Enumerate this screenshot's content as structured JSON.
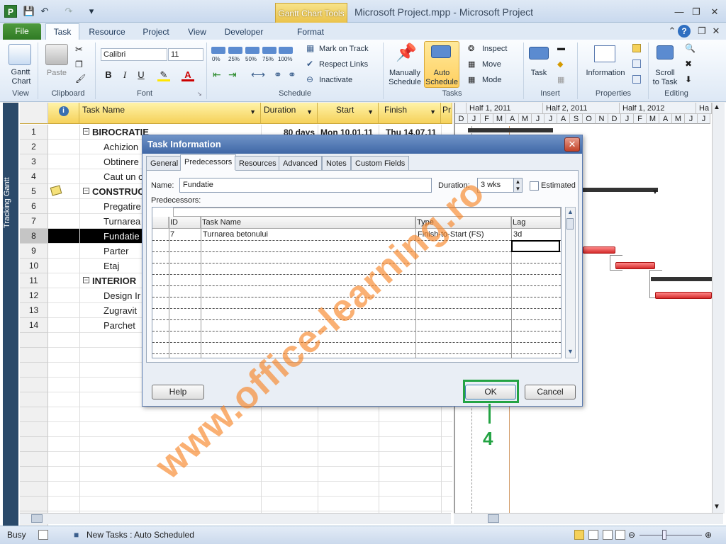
{
  "window": {
    "title": "Microsoft Project.mpp - Microsoft Project",
    "context_tab": "Gantt Chart Tools"
  },
  "tabs": [
    "File",
    "Task",
    "Resource",
    "Project",
    "View",
    "Developer",
    "Format"
  ],
  "ribbon": {
    "view": {
      "gantt": "Gantt",
      "chart": "Chart",
      "label": "View"
    },
    "clipboard": {
      "paste": "Paste",
      "label": "Clipboard"
    },
    "font": {
      "family": "Calibri",
      "size": "11",
      "label": "Font",
      "bold": "B",
      "italic": "I",
      "underline": "U"
    },
    "schedule": {
      "percents": [
        "0%",
        "25%",
        "50%",
        "75%",
        "100%"
      ],
      "mark_on_track": "Mark on Track",
      "respect_links": "Respect Links",
      "inactivate": "Inactivate",
      "label": "Schedule"
    },
    "tasks": {
      "manually": "Manually",
      "schedule1": "Schedule",
      "auto": "Auto",
      "schedule2": "Schedule",
      "inspect": "Inspect",
      "move": "Move",
      "mode": "Mode",
      "label": "Tasks"
    },
    "insert": {
      "task": "Task",
      "label": "Insert"
    },
    "properties": {
      "information": "Information",
      "label": "Properties"
    },
    "editing": {
      "scroll": "Scroll",
      "to_task": "to Task",
      "label": "Editing"
    }
  },
  "sidebar": {
    "label": "Tracking Gantt"
  },
  "grid": {
    "headers": {
      "task_name": "Task Name",
      "duration": "Duration",
      "start": "Start",
      "finish": "Finish",
      "pr": "Pr"
    },
    "summary_row": {
      "duration": "80 days",
      "start": "Mon 10.01.11",
      "finish": "Thu 14.07.11"
    },
    "rows": [
      {
        "id": "1",
        "name": "BIROCRATIE",
        "summary": true
      },
      {
        "id": "2",
        "name": "Achizion"
      },
      {
        "id": "3",
        "name": "Obtinere"
      },
      {
        "id": "4",
        "name": "Caut un c"
      },
      {
        "id": "5",
        "name": "CONSTRUCT",
        "summary": true
      },
      {
        "id": "6",
        "name": "Pregatire"
      },
      {
        "id": "7",
        "name": "Turnarea"
      },
      {
        "id": "8",
        "name": "Fundatie",
        "selected": true
      },
      {
        "id": "9",
        "name": "Parter"
      },
      {
        "id": "10",
        "name": "Etaj"
      },
      {
        "id": "11",
        "name": "INTERIOR",
        "summary": true
      },
      {
        "id": "12",
        "name": "Design Ir"
      },
      {
        "id": "13",
        "name": "Zugravit"
      },
      {
        "id": "14",
        "name": "Parchet"
      }
    ]
  },
  "gantt": {
    "halves": [
      "Half 1, 2011",
      "Half 2, 2011",
      "Half 1, 2012",
      "Ha"
    ],
    "months": [
      "D",
      "J",
      "F",
      "M",
      "A",
      "M",
      "J",
      "J",
      "A",
      "S",
      "O",
      "N",
      "D",
      "J",
      "F",
      "M",
      "A",
      "M",
      "J",
      "J"
    ]
  },
  "dialog": {
    "title": "Task Information",
    "tabs": [
      "General",
      "Predecessors",
      "Resources",
      "Advanced",
      "Notes",
      "Custom Fields"
    ],
    "name_label": "Name:",
    "name_value": "Fundatie",
    "duration_label": "Duration:",
    "duration_value": "3 wks",
    "estimated_label": "Estimated",
    "predecessors_label": "Predecessors:",
    "columns": [
      "ID",
      "Task Name",
      "Type",
      "Lag"
    ],
    "pred_rows": [
      {
        "id": "7",
        "task": "Turnarea betonului",
        "type": "Finish-to-Start (FS)",
        "lag": "3d"
      }
    ],
    "help": "Help",
    "ok": "OK",
    "cancel": "Cancel"
  },
  "callout": {
    "number": "4"
  },
  "watermark": "www.office-learning.ro",
  "status": {
    "mode": "Busy",
    "new_tasks": "New Tasks : Auto Scheduled"
  },
  "colors": {
    "accent_green": "#23a343",
    "header_yellow": "#f5d15a",
    "bar_red": "#d42b2b",
    "watermark_orange": "#f88628"
  }
}
